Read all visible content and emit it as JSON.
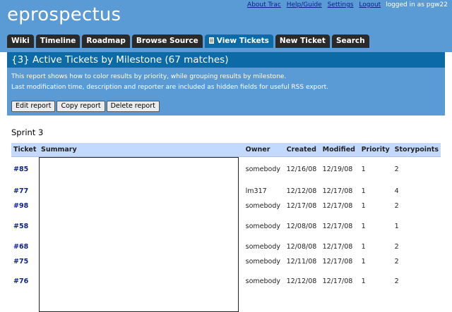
{
  "header": {
    "brand": "eprospectus",
    "metanav": {
      "links": [
        "About Trac",
        "Help/Guide",
        "Settings",
        "Logout"
      ],
      "logged_in": "logged in as pgw22"
    }
  },
  "nav": {
    "tabs": [
      {
        "label": "Wiki",
        "active": false
      },
      {
        "label": "Timeline",
        "active": false
      },
      {
        "label": "Roadmap",
        "active": false
      },
      {
        "label": "Browse Source",
        "active": false
      },
      {
        "label": "View Tickets",
        "active": true,
        "icon": "document-icon"
      },
      {
        "label": "New Ticket",
        "active": false
      },
      {
        "label": "Search",
        "active": false
      }
    ]
  },
  "report": {
    "title": "{3} Active Tickets by Milestone (67 matches)",
    "description_lines": [
      "This report shows how to color results by priority, while grouping results by milestone.",
      "Last modification time, description and reporter are included as hidden fields for useful RSS export."
    ],
    "buttons": [
      "Edit report",
      "Copy report",
      "Delete report"
    ]
  },
  "group": {
    "title": "Sprint 3",
    "columns": [
      "Ticket",
      "Summary",
      "Owner",
      "Created",
      "Modified",
      "Priority",
      "Storypoints"
    ],
    "rows": [
      {
        "ticket": "#85",
        "owner": "somebody",
        "created": "12/16/08",
        "modified": "12/19/08",
        "priority": "1",
        "storypoints": "2"
      },
      {
        "ticket": "#77",
        "owner": "lm317",
        "created": "12/12/08",
        "modified": "12/17/08",
        "priority": "1",
        "storypoints": "4"
      },
      {
        "ticket": "#98",
        "owner": "somebody",
        "created": "12/17/08",
        "modified": "12/17/08",
        "priority": "1",
        "storypoints": "2"
      },
      {
        "ticket": "#58",
        "owner": "somebody",
        "created": "12/08/08",
        "modified": "12/17/08",
        "priority": "1",
        "storypoints": "1"
      },
      {
        "ticket": "#68",
        "owner": "somebody",
        "created": "12/08/08",
        "modified": "12/17/08",
        "priority": "1",
        "storypoints": "2"
      },
      {
        "ticket": "#75",
        "owner": "somebody",
        "created": "12/11/08",
        "modified": "12/17/08",
        "priority": "1",
        "storypoints": "2"
      },
      {
        "ticket": "#76",
        "owner": "somebody",
        "created": "12/12/08",
        "modified": "12/17/08",
        "priority": "1",
        "storypoints": "2"
      }
    ]
  },
  "colors": {
    "header_bg": "#5b9bd5",
    "title_bar": "#0c6aa6",
    "tab_bg": "#2a2a2a",
    "table_header": "#c3d9ff",
    "link": "#0b1f8a"
  }
}
